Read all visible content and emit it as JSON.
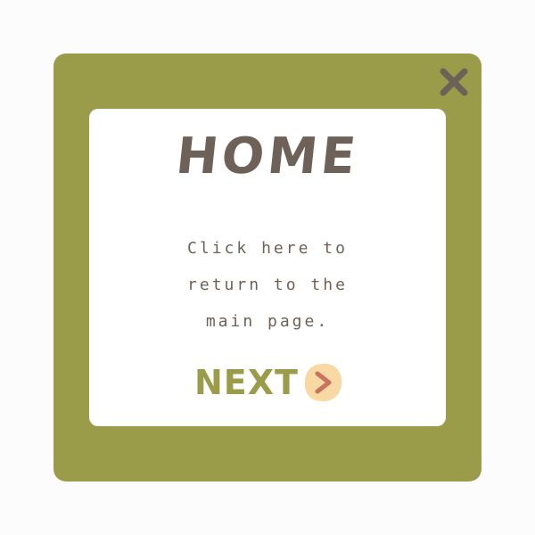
{
  "window": {
    "close_icon": "close-x-icon",
    "panel": {
      "title": "HOME",
      "body_lines": [
        "Click here to",
        "return to the",
        "main page."
      ],
      "next_label": "NEXT",
      "next_icon": "chevron-right-icon"
    }
  },
  "colors": {
    "frame": "#9a9c4a",
    "panel": "#ffffff",
    "text": "#6e6258",
    "arrow_badge": "#f8d9a4",
    "arrow": "#c9735e"
  }
}
